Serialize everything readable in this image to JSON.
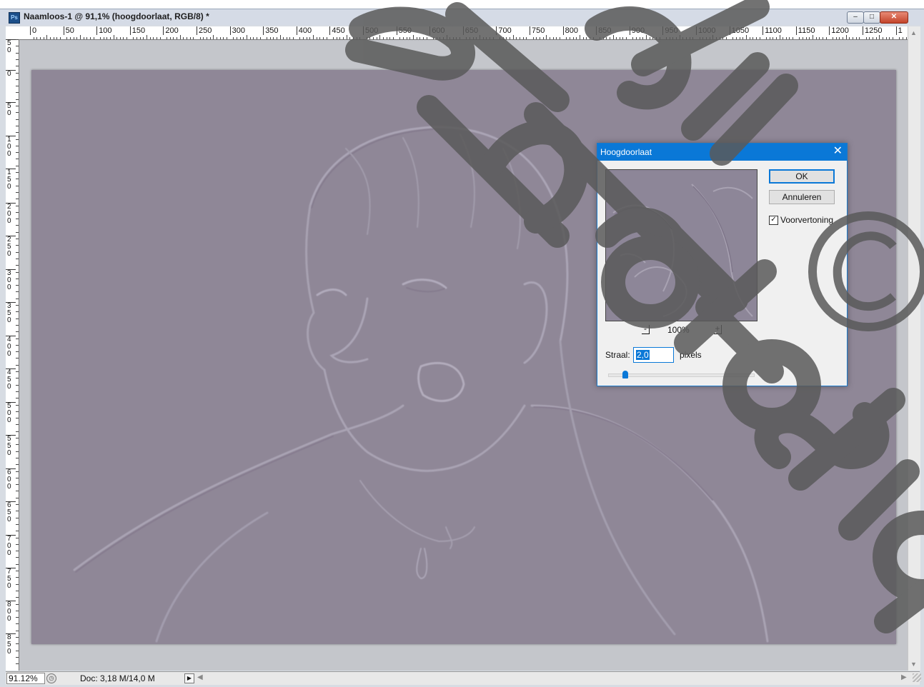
{
  "window": {
    "title": "Naamloos-1 @ 91,1% (hoogdoorlaat, RGB/8) *",
    "app_icon": "Ps",
    "controls": {
      "minimize": "‒",
      "maximize": "□",
      "close": "✕"
    }
  },
  "rulers": {
    "horizontal": [
      "0",
      "50",
      "100",
      "150",
      "200",
      "250",
      "300",
      "350",
      "400",
      "450",
      "500",
      "550",
      "600",
      "650",
      "700",
      "750",
      "800",
      "850",
      "900",
      "950",
      "1000",
      "1050",
      "1100",
      "1150",
      "1200",
      "1250",
      "1"
    ],
    "vertical": [
      "5\n0",
      "0",
      "5\n0",
      "1\n0\n0",
      "1\n5\n0",
      "2\n0\n0",
      "2\n5\n0",
      "3\n0\n0",
      "3\n5\n0",
      "4\n0\n0",
      "4\n5\n0",
      "5\n0\n0",
      "5\n5\n0",
      "6\n0\n0",
      "6\n5\n0",
      "7\n0\n0",
      "7\n5\n0",
      "8\n0\n0",
      "8\n5\n0"
    ]
  },
  "status": {
    "zoom": "91.12%",
    "doc": "Doc: 3,18 M/14,0 M",
    "menu_arrow": "▶"
  },
  "dialog": {
    "title": "Hoogdoorlaat",
    "close": "✕",
    "ok": "OK",
    "cancel": "Annuleren",
    "preview_label": "Voorvertoning",
    "preview_checked": true,
    "zoom_out": "-",
    "zoom_in": "+",
    "zoom_level": "100%",
    "radius_label": "Straal:",
    "radius_value": "2,0",
    "radius_unit": "pixels",
    "slider_fraction": 0.1
  },
  "colors": {
    "canvas": "#8f8797",
    "dialog_accent": "#0a78d7",
    "watermark": "#5a5a5a"
  },
  "watermark": {
    "text": "© photoshop",
    "icon": "copyright-icon"
  }
}
